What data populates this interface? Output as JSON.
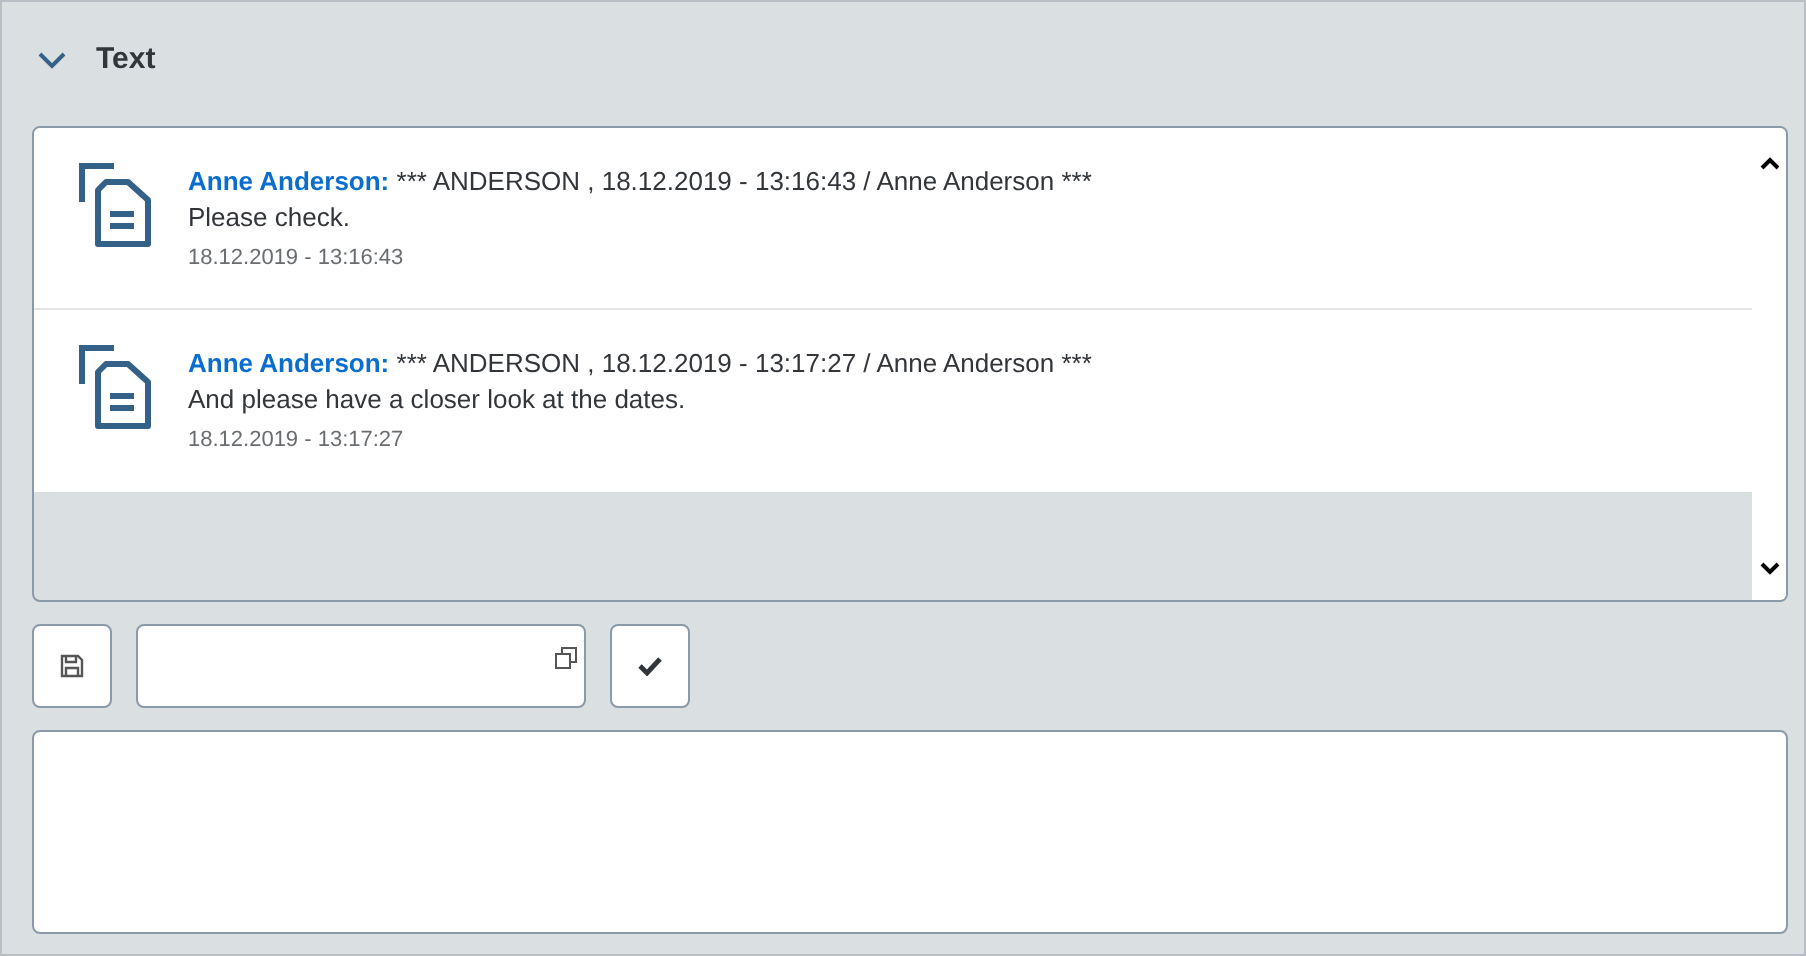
{
  "section": {
    "title": "Text",
    "expanded": true
  },
  "comments": [
    {
      "author": "Anne Anderson:",
      "header": "*** ANDERSON , 18.12.2019 - 13:16:43 / Anne Anderson ***",
      "text": "Please check.",
      "timestamp": "18.12.2019 - 13:16:43"
    },
    {
      "author": "Anne Anderson:",
      "header": "*** ANDERSON , 18.12.2019 - 13:17:27 / Anne Anderson ***",
      "text": "And please have a closer look at the dates.",
      "timestamp": "18.12.2019 - 13:17:27"
    }
  ]
}
